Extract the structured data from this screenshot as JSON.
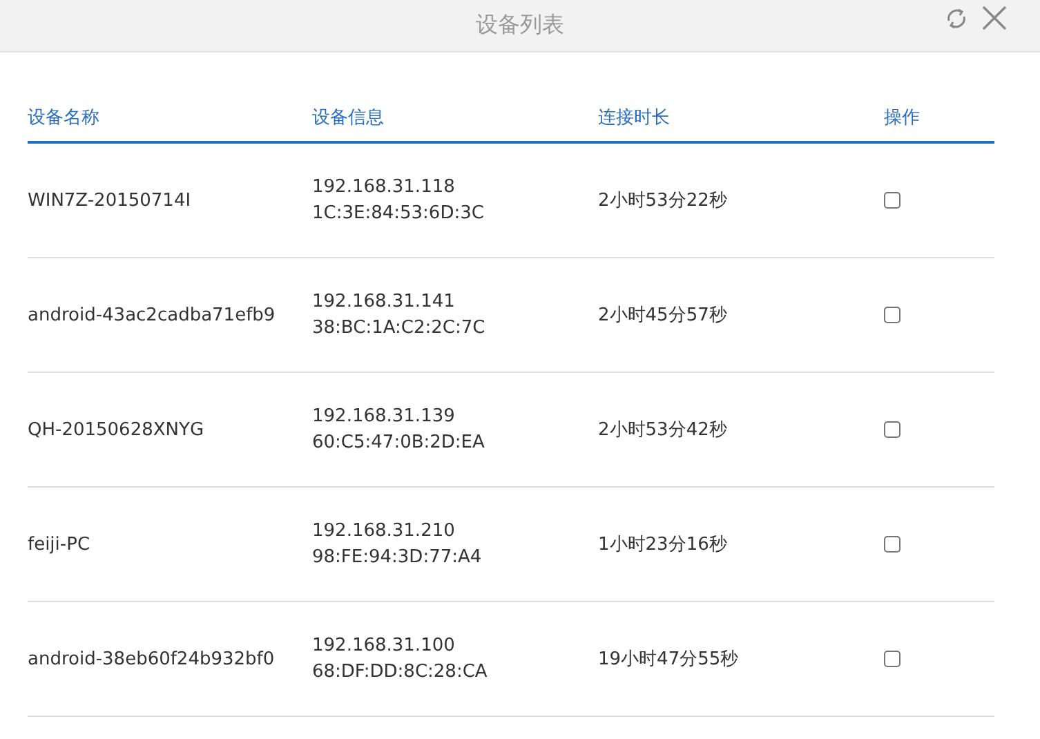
{
  "window": {
    "title": "设备列表"
  },
  "table": {
    "columns": [
      "设备名称",
      "设备信息",
      "连接时长",
      "操作"
    ],
    "rows": [
      {
        "name": "WIN7Z-20150714I",
        "ip": "192.168.31.118",
        "mac": "1C:3E:84:53:6D:3C",
        "duration": "2小时53分22秒",
        "checked": false
      },
      {
        "name": "android-43ac2cadba71efb9",
        "ip": "192.168.31.141",
        "mac": "38:BC:1A:C2:2C:7C",
        "duration": "2小时45分57秒",
        "checked": false
      },
      {
        "name": "QH-20150628XNYG",
        "ip": "192.168.31.139",
        "mac": "60:C5:47:0B:2D:EA",
        "duration": "2小时53分42秒",
        "checked": false
      },
      {
        "name": "feiji-PC",
        "ip": "192.168.31.210",
        "mac": "98:FE:94:3D:77:A4",
        "duration": "1小时23分16秒",
        "checked": false
      },
      {
        "name": "android-38eb60f24b932bf0",
        "ip": "192.168.31.100",
        "mac": "68:DF:DD:8C:28:CA",
        "duration": "19小时47分55秒",
        "checked": false
      }
    ]
  }
}
